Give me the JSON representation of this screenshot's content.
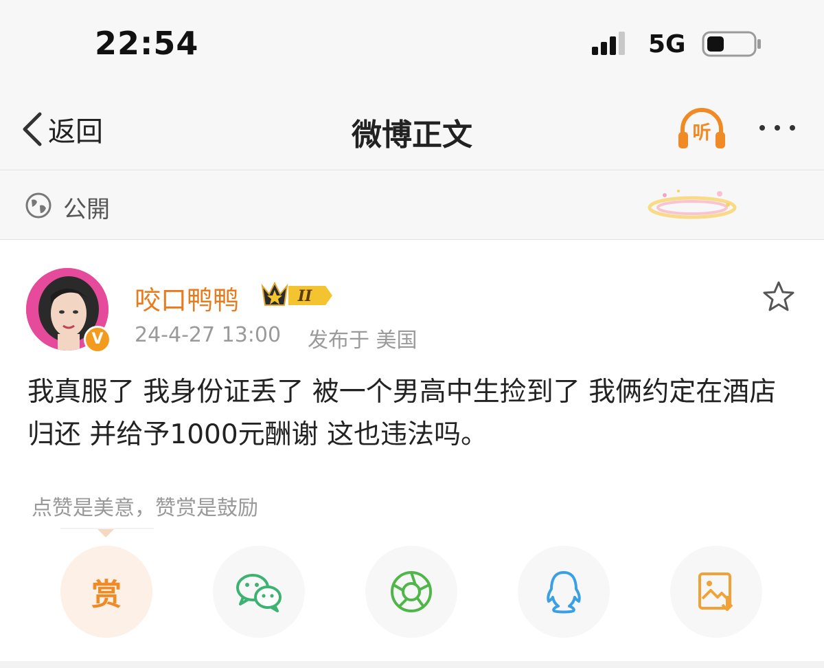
{
  "status_bar": {
    "time": "22:54",
    "network": "5G",
    "battery_icon": "battery-icon",
    "signal_icon": "signal-icon"
  },
  "nav": {
    "back_label": "返回",
    "title": "微博正文",
    "listen_label": "听",
    "more_icon": "more-icon"
  },
  "visibility": {
    "label": "公開",
    "icon": "globe-icon"
  },
  "post": {
    "username": "咬口鸭鸭",
    "member_badge": "II",
    "timestamp": "24-4-27 13:00",
    "location": "发布于 美国",
    "verified_mark": "V",
    "text": "我真服了 我身份证丢了 被一个男高中生捡到了 我俩约定在酒店归还 并给予1000元酬谢 这也违法吗。",
    "reward_hint": "点赞是美意，赞赏是鼓励"
  },
  "share": {
    "reward_label": "赏",
    "icons": [
      "wechat-icon",
      "moments-icon",
      "qq-icon",
      "save-image-icon"
    ]
  },
  "colors": {
    "accent": "#ea7a1c",
    "gray": "#9a9a9a",
    "background": "#f7f7f7"
  }
}
